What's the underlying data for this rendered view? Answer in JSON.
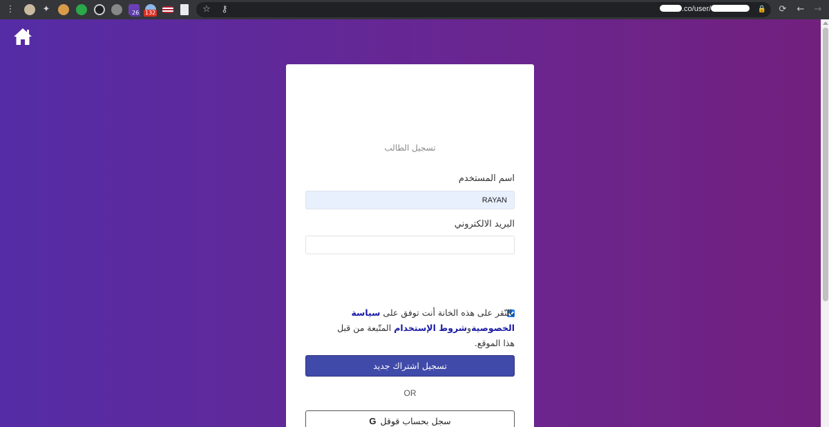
{
  "browser": {
    "url_host_end": ".co/user/",
    "extension_badges": [
      "26",
      "132"
    ],
    "icons": [
      "menu-icon",
      "avatar-icon",
      "extensions-icon",
      "cookie-icon",
      "globe-icon",
      "refresh-icon",
      "lock-icon",
      "star-icon",
      "key-icon",
      "back-icon"
    ]
  },
  "page": {
    "background_from": "#552ca6",
    "background_to": "#72207e",
    "home_icon": "home-icon"
  },
  "form": {
    "title": "تسجيل الطالب",
    "username_label": "اسم المستخدم",
    "username_value": "RAYAN",
    "email_label": "البريد الالكتروني",
    "email_value": "",
    "consent_prefix": "بالنّقر على هذه الخانة أنت توفق على",
    "privacy_link": "سياسة الخصوصية",
    "consent_and": "و",
    "terms_link": "شروط الإستخدام",
    "consent_suffix": "المتّبعة من قبل هذا الموقع.",
    "consent_checked": true,
    "register_button": "تسجيل اشتراك جديد",
    "or_text": "OR",
    "google_button": "سجل بحساب قوقل",
    "google_icon": "google-g-icon"
  }
}
